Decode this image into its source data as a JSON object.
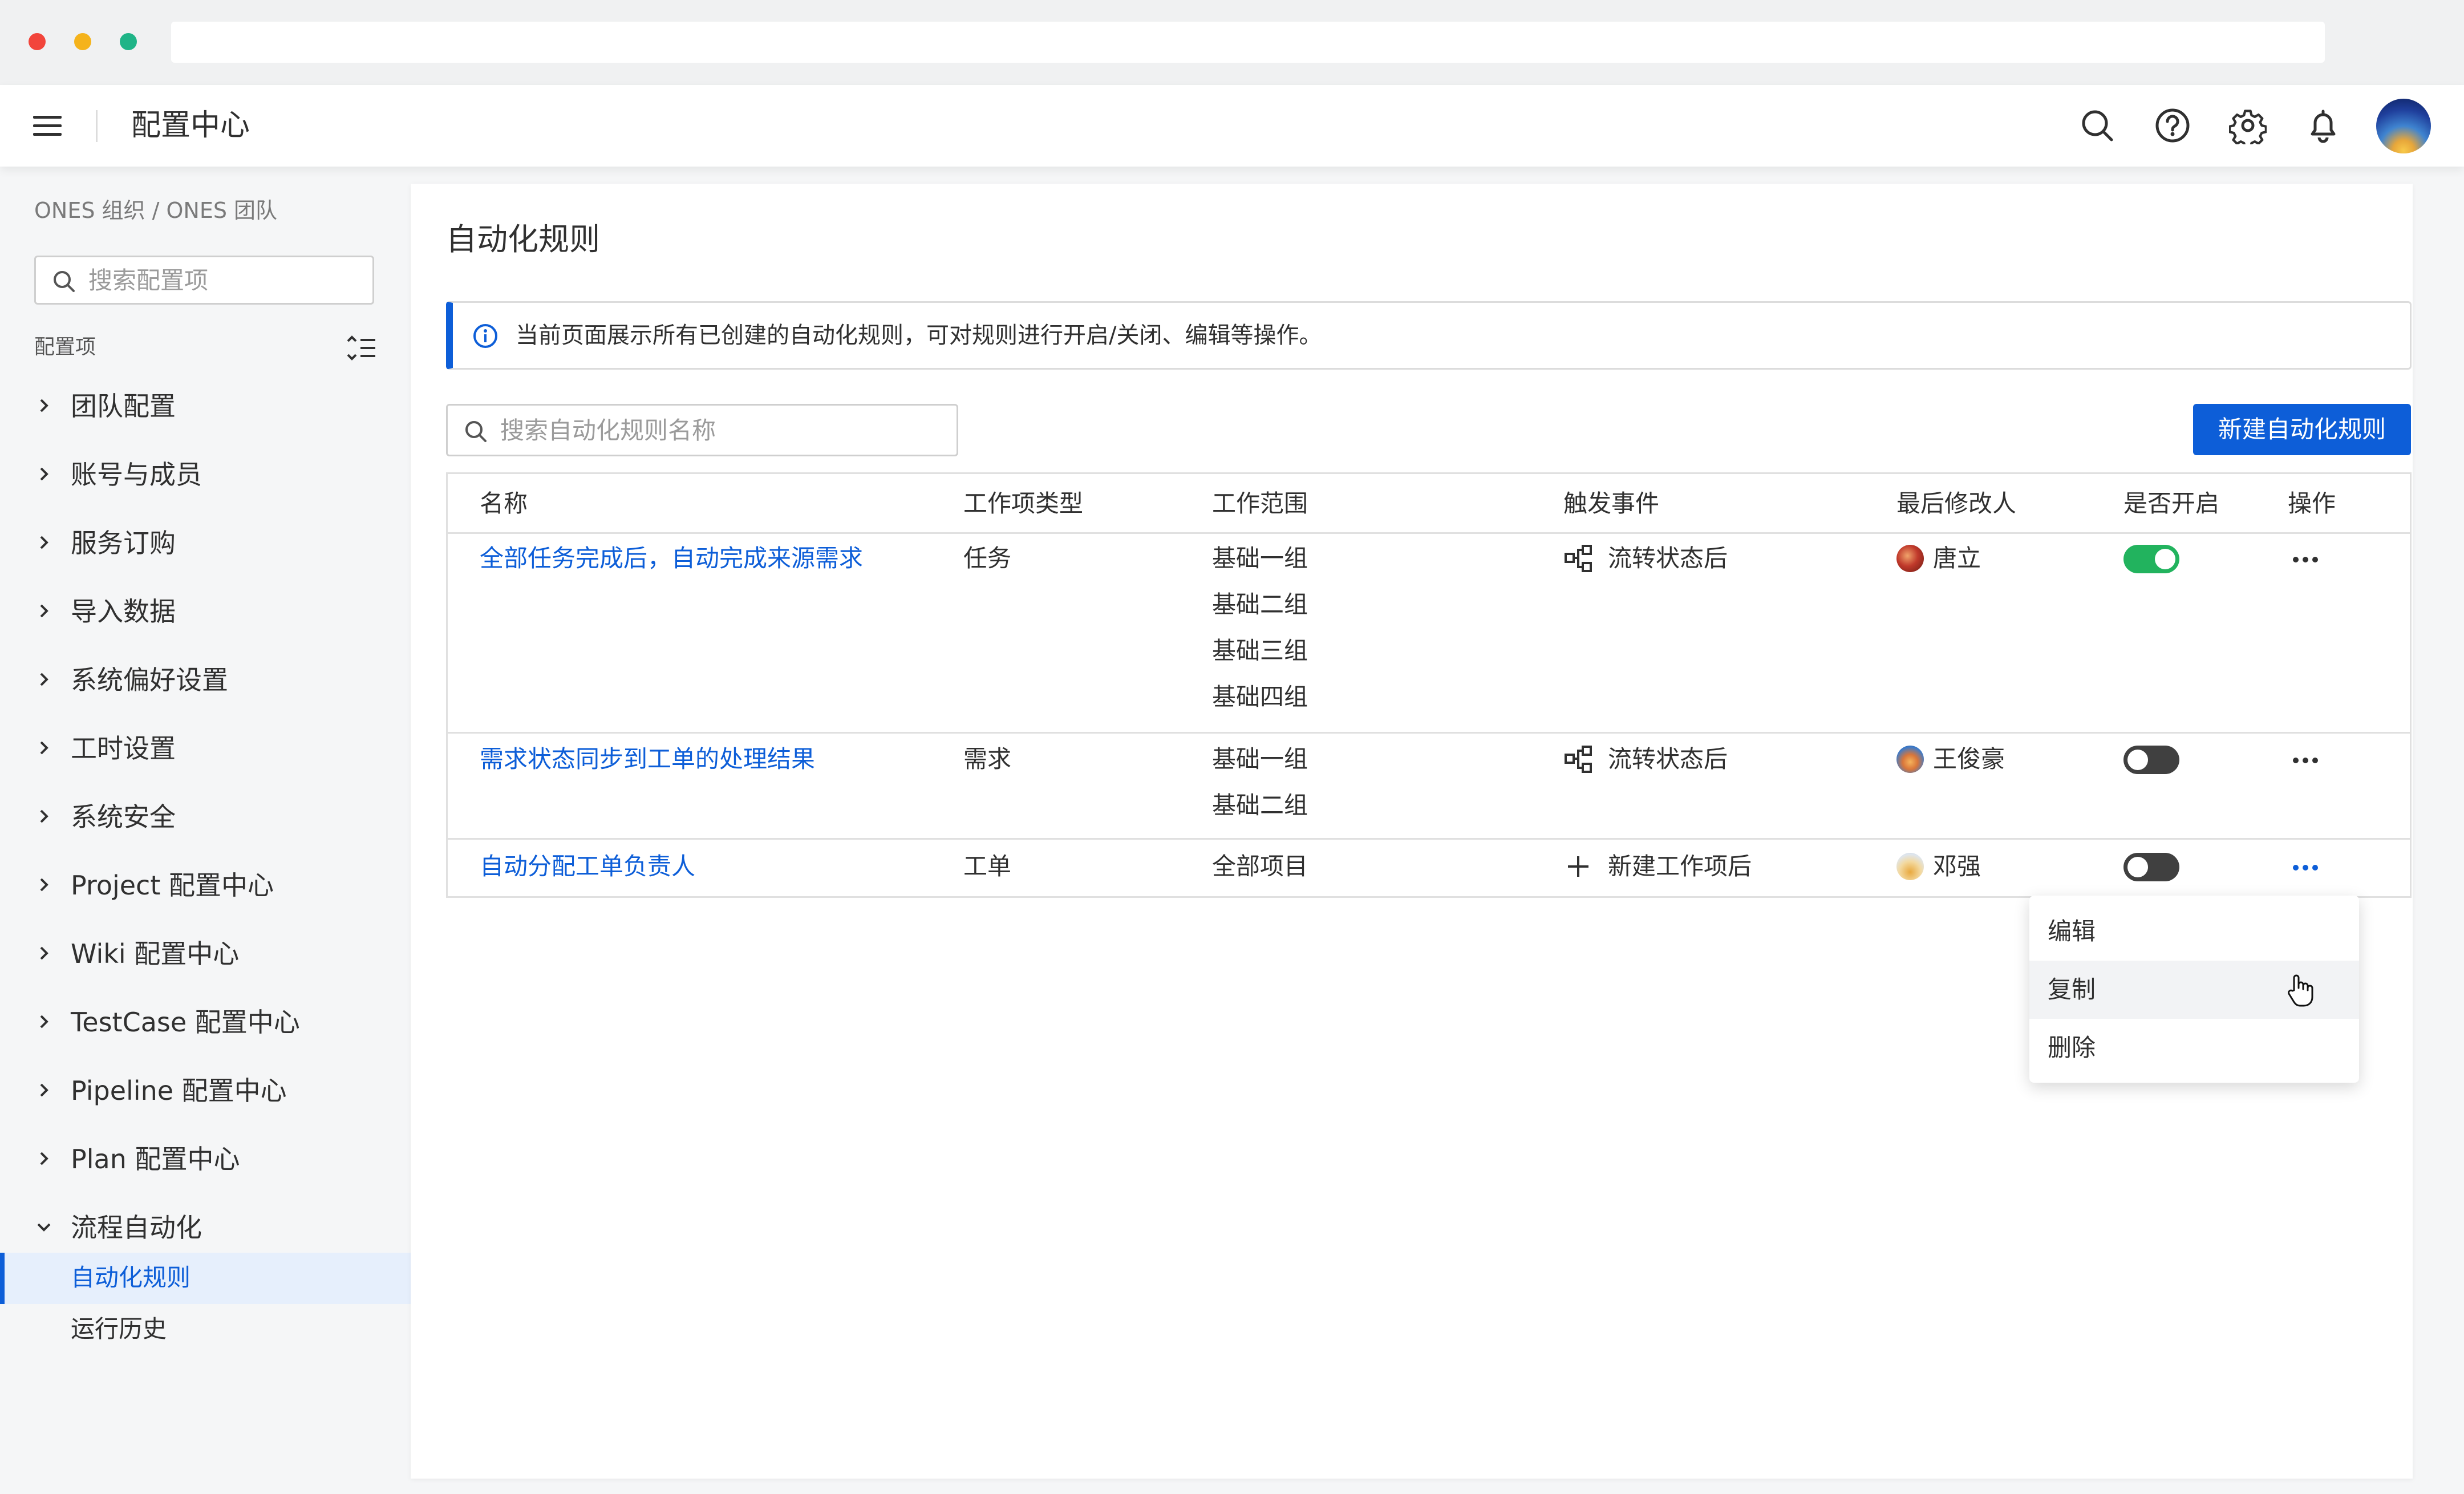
{
  "header": {
    "title": "配置中心"
  },
  "sidebar": {
    "breadcrumb": "ONES 组织 / ONES 团队",
    "search_placeholder": "搜索配置项",
    "section_label": "配置项",
    "items": [
      {
        "label": "团队配置",
        "expanded": false
      },
      {
        "label": "账号与成员",
        "expanded": false
      },
      {
        "label": "服务订购",
        "expanded": false
      },
      {
        "label": "导入数据",
        "expanded": false
      },
      {
        "label": "系统偏好设置",
        "expanded": false
      },
      {
        "label": "工时设置",
        "expanded": false
      },
      {
        "label": "系统安全",
        "expanded": false
      },
      {
        "label": "Project 配置中心",
        "expanded": false
      },
      {
        "label": "Wiki 配置中心",
        "expanded": false
      },
      {
        "label": "TestCase 配置中心",
        "expanded": false
      },
      {
        "label": "Pipeline 配置中心",
        "expanded": false
      },
      {
        "label": "Plan 配置中心",
        "expanded": false
      },
      {
        "label": "流程自动化",
        "expanded": true
      }
    ],
    "sub_items": [
      {
        "label": "自动化规则",
        "active": true
      },
      {
        "label": "运行历史",
        "active": false
      }
    ]
  },
  "main": {
    "title": "自动化规则",
    "info_text": "当前页面展示所有已创建的自动化规则，可对规则进行开启/关闭、编辑等操作。",
    "search_placeholder": "搜索自动化规则名称",
    "new_button": "新建自动化规则",
    "table": {
      "headers": [
        "名称",
        "工作项类型",
        "工作范围",
        "触发事件",
        "最后修改人",
        "是否开启",
        "操作"
      ],
      "rows": [
        {
          "name": "全部任务完成后，自动完成来源需求",
          "type": "任务",
          "scope": [
            "基础一组",
            "基础二组",
            "基础三组",
            "基础四组"
          ],
          "trigger": "流转状态后",
          "trigger_icon": "workflow-icon",
          "modifier": "唐立",
          "enabled": true
        },
        {
          "name": "需求状态同步到工单的处理结果",
          "type": "需求",
          "scope": [
            "基础一组",
            "基础二组"
          ],
          "trigger": "流转状态后",
          "trigger_icon": "workflow-icon",
          "modifier": "王俊豪",
          "enabled": false
        },
        {
          "name": "自动分配工单负责人",
          "type": "工单",
          "scope": [
            "全部项目"
          ],
          "trigger": "新建工作项后",
          "trigger_icon": "plus-icon",
          "modifier": "邓强",
          "enabled": false
        }
      ]
    },
    "actions_menu": {
      "items": [
        "编辑",
        "复制",
        "删除"
      ],
      "hovered": "复制"
    }
  },
  "colors": {
    "accent": "#0d5ed8",
    "toggle_on": "#22b35e",
    "toggle_off": "#404040",
    "sidebar_active_bg": "#e6effc"
  }
}
